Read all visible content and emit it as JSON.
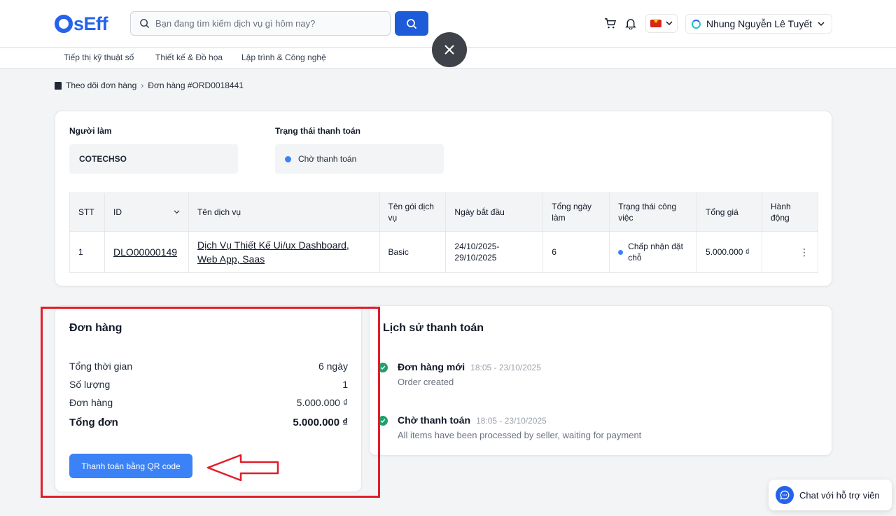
{
  "header": {
    "logo_text": "sEff",
    "search_placeholder": "Bạn đang tìm kiếm dịch vụ gì hôm nay?",
    "user_name": "Nhung Nguyễn Lê Tuyết"
  },
  "nav": {
    "items": [
      {
        "label": "Tiếp thị kỹ thuật số"
      },
      {
        "label": "Thiết kế & Đồ họa"
      },
      {
        "label": "Lập trình & Công nghệ"
      }
    ]
  },
  "breadcrumb": {
    "parent": "Theo dõi đơn hàng",
    "current": "Đơn hàng #ORD0018441"
  },
  "order_info": {
    "worker_label": "Người làm",
    "worker_value": "COTECHSO",
    "payment_status_label": "Trạng thái thanh toán",
    "payment_status_value": "Chờ thanh toán"
  },
  "table": {
    "headers": [
      "STT",
      "ID",
      "Tên dịch vụ",
      "Tên gói dịch vụ",
      "Ngày bắt đầu",
      "Tổng ngày làm",
      "Trạng thái công việc",
      "Tổng giá",
      "Hành động"
    ],
    "rows": [
      {
        "stt": "1",
        "id": "DLO00000149",
        "service": "Dịch Vụ Thiết Kế Ui/ux Dashboard, Web App, Saas",
        "package": "Basic",
        "start_date": "24/10/2025- 29/10/2025",
        "total_days": "6",
        "work_status": "Chấp nhận đặt chỗ",
        "price": "5.000.000 ₫"
      }
    ]
  },
  "summary": {
    "title": "Đơn hàng",
    "total_time_label": "Tổng thời gian",
    "total_time_value": "6 ngày",
    "quantity_label": "Số lượng",
    "quantity_value": "1",
    "order_label": "Đơn hàng",
    "order_value": "5.000.000 ₫",
    "grand_total_label": "Tổng đơn",
    "grand_total_value": "5.000.000 ₫",
    "qr_button": "Thanh toán bằng QR code"
  },
  "history": {
    "title": "Lịch sử thanh toán",
    "events": [
      {
        "title": "Đơn hàng mới",
        "time": "18:05 - 23/10/2025",
        "desc": "Order created"
      },
      {
        "title": "Chờ thanh toán",
        "time": "18:05 - 23/10/2025",
        "desc": "All items have been processed by seller, waiting for payment"
      }
    ]
  },
  "chat": {
    "label": "Chat với hỗ trợ viên"
  },
  "colors": {
    "primary": "#1d5bd8",
    "highlight": "#e11d2a",
    "success": "#22a06b"
  }
}
